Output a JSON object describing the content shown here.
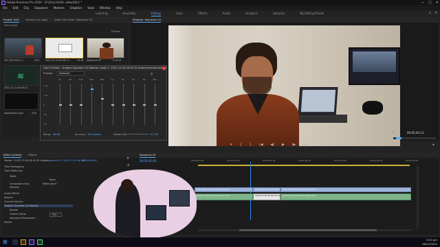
{
  "app": {
    "title": "Adobe Premiere Pro 2019 - D:\\Chicchi\\Ofc video\\Ofc1 *",
    "window_controls": [
      "—",
      "□",
      "✕"
    ]
  },
  "menu": [
    "File",
    "Edit",
    "Clip",
    "Sequence",
    "Markers",
    "Graphics",
    "View",
    "Window",
    "Help"
  ],
  "workspaces": {
    "items": [
      "Learning",
      "Assembly",
      "Editing",
      "Color",
      "Effects",
      "Audio",
      "Graphics",
      "Libraries",
      "My Editing Preset"
    ],
    "active": "Editing"
  },
  "project_panel": {
    "tabs": [
      "Project: Ofc1",
      "Source: (no clips)",
      "Audio Clip Mixer: Sequence 03"
    ],
    "active_tab": "Project: Ofc1",
    "path_text": "Ofc1.prproj",
    "item_count": "9 Items",
    "thumbnails": [
      {
        "label": "VID_20221224_1...",
        "duration": "0:05"
      },
      {
        "label": "2022-12-14 06-46-17...",
        "duration": "10:16"
      },
      {
        "label": "Sequence 03",
        "duration": "5:13:20"
      },
      {
        "label": "2022-12-14 06-46-01...",
        "duration": ""
      },
      {
        "label": "Adjustment Layer",
        "duration": "5:00"
      }
    ]
  },
  "eq_dialog": {
    "title": "Clip Fx Editor - Graphic Equalizer (10 Bands): Audio 1, 2022-12-04 06-40-32 Audio Extracted.wav, Transition...",
    "presets_label": "Presets:",
    "preset_value": "(Default)",
    "freq_labels": [
      "31",
      "63",
      "125",
      "250",
      "500",
      "1k",
      "2k",
      "4k",
      "8k",
      "16k"
    ],
    "db_labels": [
      "+20",
      "+10",
      "0",
      "-10",
      "-20"
    ],
    "slider_levels": [
      0.5,
      0.5,
      0.5,
      0.12,
      0.35,
      0.5,
      0.5,
      0.5,
      0.5,
      0.5
    ],
    "range_label": "Range",
    "range_value": "48 dB",
    "accuracy_label": "Accuracy",
    "accuracy_value": "1000 points",
    "master_gain_label": "Master Gain",
    "master_gain_value": "0.0 dB"
  },
  "program_monitor": {
    "tab": "Program: Sequence 03",
    "timecode_right": "00;05;04;13",
    "timecode_left": "00;00;45;04"
  },
  "effect_controls": {
    "tabs": [
      "Effect Controls",
      "Effects"
    ],
    "master": "Master * 2022-12-04 06-40-32 Audio...",
    "sequence": "Sequence 03 * 2022-12-14 06-46...",
    "timecode": "00;00;45;04",
    "rows": [
      "Time Remapping",
      "Track Matte Key",
      "Matte",
      "Composite using",
      "Reverse",
      "Audio Effects",
      "Volume",
      "Channel Volume",
      "Graphic Equalizer (10 Bands)",
      "Bypass",
      "Custom Setup",
      "Individual Parameters",
      "Panner"
    ],
    "composite_value": "Matte Alpha",
    "matte_value": "None",
    "custom_setup_button": "Edit..."
  },
  "timeline": {
    "tab": "Sequence 03",
    "timecode": "00;00;45;04",
    "ruler": [
      "00;00;43;28",
      "00;00;44;28",
      "00;00;45;28",
      "00;00;46;28",
      "00;00;47;28",
      "00;00;48;28",
      "00;00;49;28"
    ],
    "clips": [
      {
        "label": "VID_20221224_124940.mp4 [V]"
      },
      {
        "label": "VID_20221224_124940.mp4 [V]"
      },
      {
        "label": "VID_20221224_124940.mp4 [V]"
      },
      {
        "label": "2022-12-04 06-40-32 Audio Ext..."
      },
      {
        "label": "2022-12-04 06-40-32 Audio Ext..."
      },
      {
        "label": "2022-12-04 06-40-32 Audio Ext..."
      }
    ]
  },
  "taskbar": {
    "time": "9:30 pm",
    "date": "06/12/2022"
  },
  "colors": {
    "accent_blue": "#5aa9ff",
    "clip_video": "#9db4d8",
    "clip_audio": "#7fb38a",
    "playhead": "#2f8cff"
  }
}
